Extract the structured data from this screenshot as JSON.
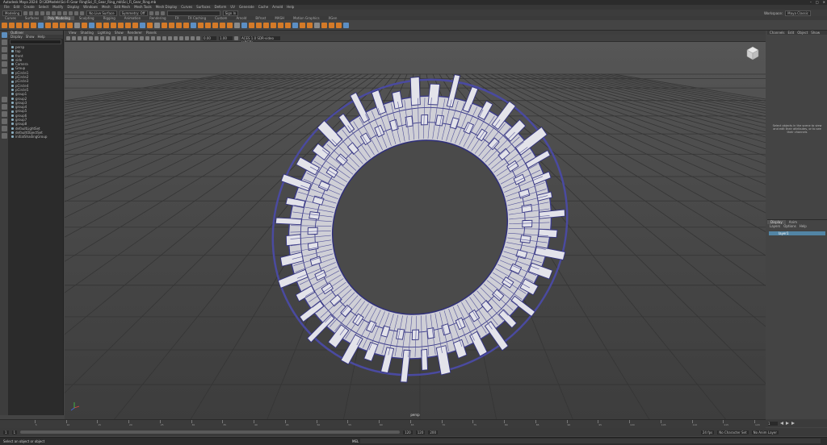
{
  "window": {
    "title": "Autodesk Maya 2024: D:\\3DModels\\Sci-Fi Gear Ring\\Sci_Fi_Gear_Ring_mb\\Sci_Fi_Gear_Ring.mb",
    "controls": [
      "–",
      "□",
      "✕"
    ]
  },
  "menus": [
    "File",
    "Edit",
    "Create",
    "Select",
    "Modify",
    "Display",
    "Windows",
    "Mesh",
    "Edit Mesh",
    "Mesh Tools",
    "Mesh Display",
    "Curves",
    "Surfaces",
    "Deform",
    "UV",
    "Generate",
    "Cache",
    "Arnold",
    "Help"
  ],
  "workspace": {
    "label": "Workspace:",
    "value": "Maya Classic"
  },
  "status": {
    "mode": "Modeling",
    "no_live": "No Live Surface",
    "symmetry": "Symmetry: Off",
    "signin": "Sign In"
  },
  "shelf_tabs": [
    "Curves",
    "Surfaces",
    "Poly Modeling",
    "Sculpting",
    "Rigging",
    "Animation",
    "Rendering",
    "FX",
    "FX Caching",
    "Custom",
    "Arnold",
    "Bifrost",
    "MASH",
    "Motion Graphics",
    "XGen"
  ],
  "shelf_active": "Poly Modeling",
  "outliner": {
    "title": "Outliner",
    "menu": [
      "Display",
      "Show",
      "Help"
    ],
    "items": [
      "persp",
      "top",
      "front",
      "side",
      "Camera",
      "Group",
      "pCircle1",
      "pCircle2",
      "pCircle3",
      "pCircle4",
      "pCircle5",
      "group1",
      "group2",
      "group3",
      "group4",
      "group5",
      "group6",
      "group7",
      "group8",
      "defaultLightSet",
      "defaultObjectSet",
      "initialShadingGroup"
    ]
  },
  "viewport": {
    "menu": [
      "View",
      "Shading",
      "Lighting",
      "Show",
      "Renderer",
      "Panels"
    ],
    "field1": "0.00",
    "field2": "1.00",
    "colorspace": "ACES 1.0 SDR-video (sRGB)",
    "camera": "persp"
  },
  "channel_box": {
    "tabs": [
      "Channels",
      "Edit",
      "Object",
      "Show"
    ],
    "message": "Select objects in the scene to view and edit their attributes, or to see their channels"
  },
  "layers": {
    "tabs": [
      "Display",
      "Anim"
    ],
    "menu": [
      "Layers",
      "Options",
      "Help"
    ],
    "layer_name": "layer1"
  },
  "timeline": {
    "ticks": [
      "5",
      "10",
      "15",
      "20",
      "25",
      "30",
      "35",
      "40",
      "45",
      "50",
      "55",
      "60",
      "65",
      "70",
      "75",
      "80",
      "85",
      "90",
      "95",
      "100",
      "105",
      "110",
      "115",
      "120"
    ],
    "current_frame": "1",
    "start": "1",
    "end": "120",
    "range_start": "1",
    "range_end": "120",
    "max": "200",
    "fps": "24 fps",
    "char_set": "No Character Set",
    "anim_layer": "No Anim Layer"
  },
  "command": {
    "label": "Select an object or object",
    "mel": "MEL"
  }
}
